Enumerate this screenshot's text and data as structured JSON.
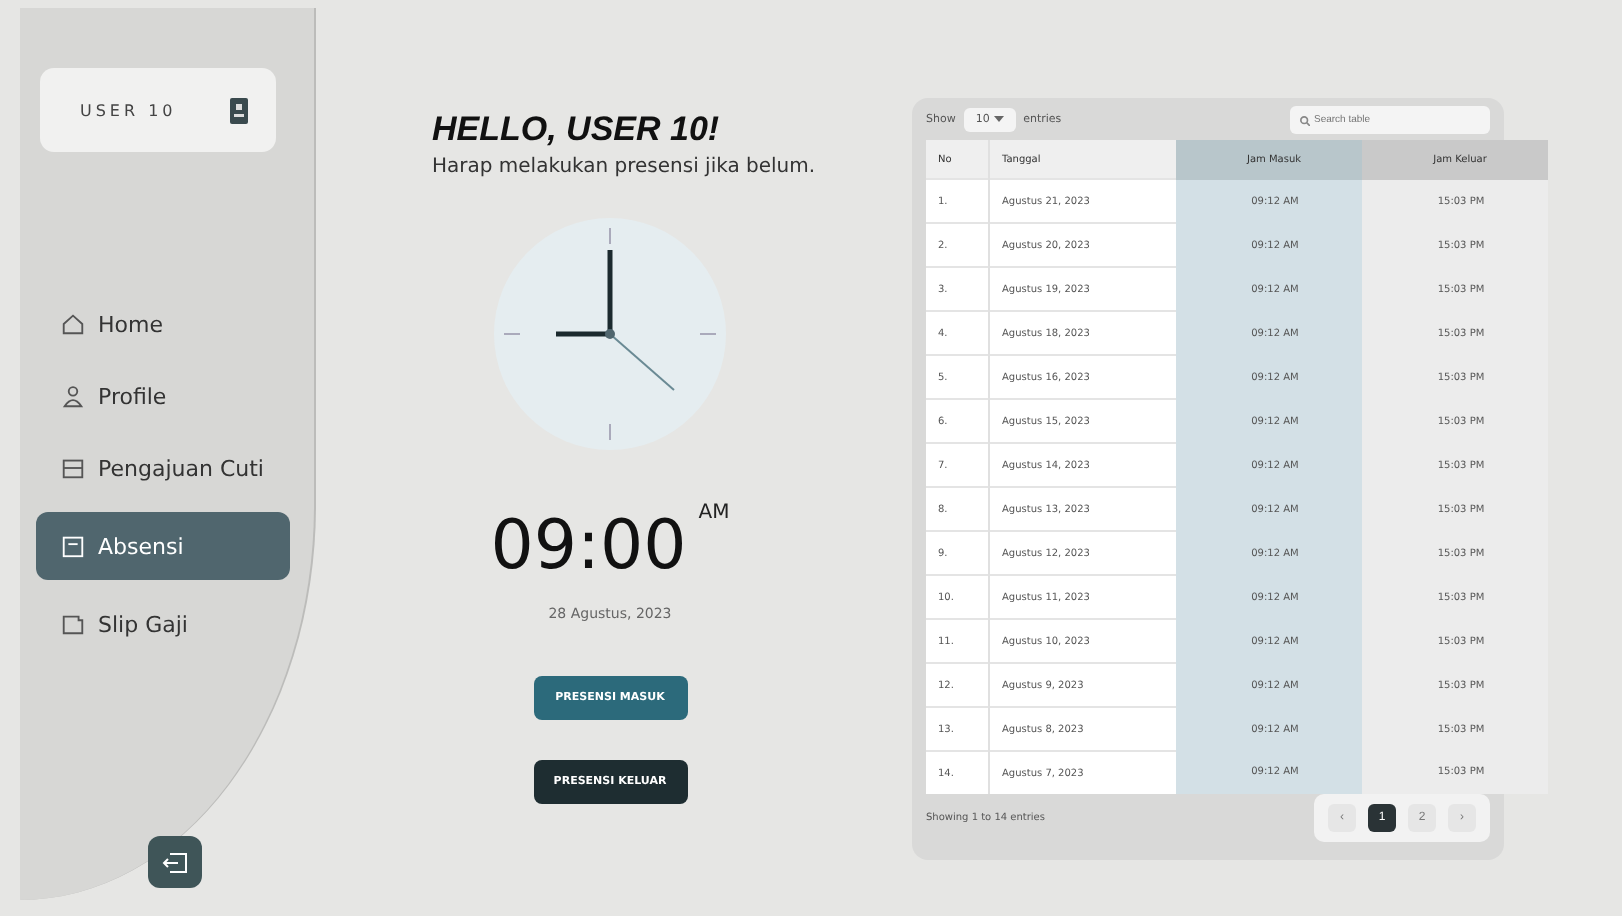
{
  "sidebar": {
    "user": "USER 10",
    "items": [
      {
        "label": "Home",
        "selected": false
      },
      {
        "label": "Profile",
        "selected": false
      },
      {
        "label": "Pengajuan Cuti",
        "selected": false
      },
      {
        "label": "Absensi",
        "selected": true
      },
      {
        "label": "Slip Gaji",
        "selected": false
      }
    ]
  },
  "greeting": {
    "title": "HELLO, USER 10!",
    "subtitle": "Harap melakukan presensi jika belum."
  },
  "clock": {
    "time": "09:00",
    "period": "AM",
    "date": "28 Agustus, 2023"
  },
  "buttons": [
    {
      "label": "PRESENSI MASUK",
      "kind": "primary"
    },
    {
      "label": "PRESENSI KELUAR",
      "kind": "dark"
    }
  ],
  "table": {
    "show_label": "Show",
    "page_size": "10",
    "entries_label": "entries",
    "search_placeholder": "Search table",
    "columns": [
      "No",
      "Tanggal",
      "Jam Masuk",
      "Jam Keluar"
    ],
    "rows": [
      [
        "1.",
        "Agustus 21, 2023",
        "09:12 AM",
        "15:03 PM"
      ],
      [
        "2.",
        "Agustus 20, 2023",
        "09:12 AM",
        "15:03 PM"
      ],
      [
        "3.",
        "Agustus 19, 2023",
        "09:12 AM",
        "15:03 PM"
      ],
      [
        "4.",
        "Agustus 18, 2023",
        "09:12 AM",
        "15:03 PM"
      ],
      [
        "5.",
        "Agustus 16, 2023",
        "09:12 AM",
        "15:03 PM"
      ],
      [
        "6.",
        "Agustus 15, 2023",
        "09:12 AM",
        "15:03 PM"
      ],
      [
        "7.",
        "Agustus 14, 2023",
        "09:12 AM",
        "15:03 PM"
      ],
      [
        "8.",
        "Agustus 13, 2023",
        "09:12 AM",
        "15:03 PM"
      ],
      [
        "9.",
        "Agustus 12, 2023",
        "09:12 AM",
        "15:03 PM"
      ],
      [
        "10.",
        "Agustus 11, 2023",
        "09:12 AM",
        "15:03 PM"
      ],
      [
        "11.",
        "Agustus 10, 2023",
        "09:12 AM",
        "15:03 PM"
      ],
      [
        "12.",
        "Agustus 9, 2023",
        "09:12 AM",
        "15:03 PM"
      ],
      [
        "13.",
        "Agustus 8, 2023",
        "09:12 AM",
        "15:03 PM"
      ],
      [
        "14.",
        "Agustus 7, 2023",
        "09:12 AM",
        "15:03 PM"
      ]
    ],
    "footer": "Showing 1 to 14 entries",
    "pagination": [
      {
        "label": "‹",
        "selected": false
      },
      {
        "label": "1",
        "selected": true
      },
      {
        "label": "2",
        "selected": false
      },
      {
        "label": "›",
        "selected": false
      }
    ]
  }
}
